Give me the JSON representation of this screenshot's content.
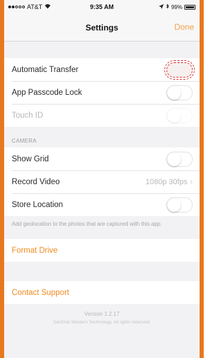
{
  "status": {
    "carrier": "AT&T",
    "wifi_icon": "wifi-icon",
    "time": "9:35 AM",
    "location_icon": "location-arrow-icon",
    "bluetooth_icon": "bluetooth-icon",
    "battery": "99%"
  },
  "nav": {
    "title": "Settings",
    "done": "Done"
  },
  "general": {
    "automatic_transfer": "Automatic Transfer",
    "app_passcode_lock": "App Passcode Lock",
    "touch_id": "Touch ID"
  },
  "camera": {
    "header": "CAMERA",
    "show_grid": "Show Grid",
    "record_video": "Record Video",
    "record_video_value": "1080p 30fps",
    "store_location": "Store Location",
    "footer": "Add geolocation to the photos that are captured with this app."
  },
  "actions": {
    "format_drive": "Format Drive",
    "contact_support": "Contact Support"
  },
  "footer": {
    "version": "Version 1.2.17",
    "copyright": "SanDisk Western Technology. All rights reserved."
  },
  "colors": {
    "accent": "#f28a1e",
    "frame": "#e8781f",
    "highlight": "#d93030"
  }
}
